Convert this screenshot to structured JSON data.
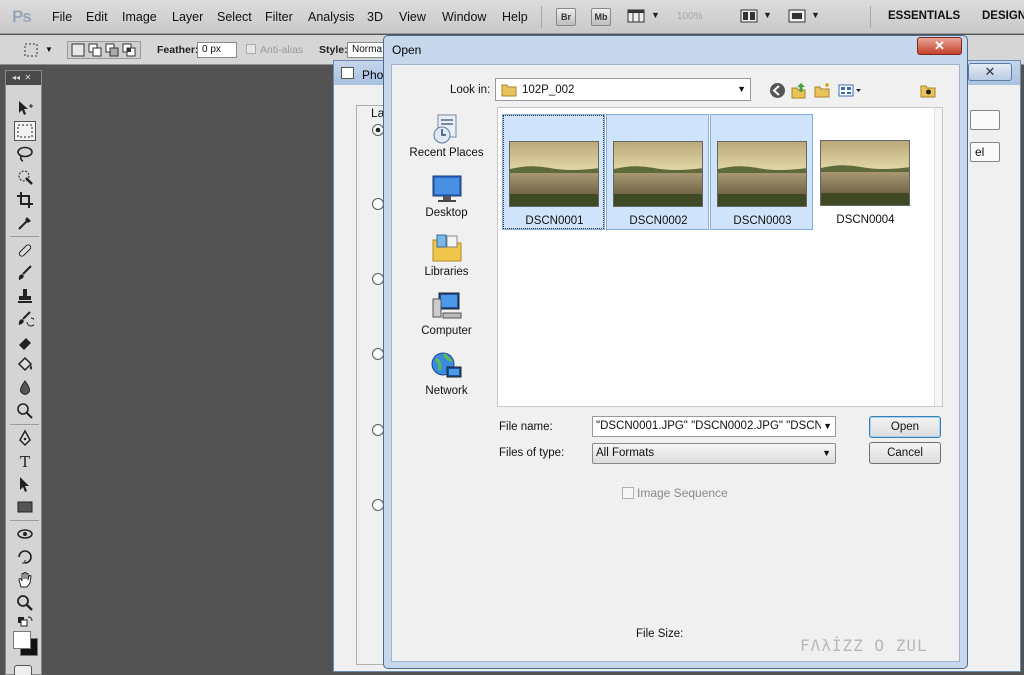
{
  "app": {
    "logo": "Ps",
    "menu": [
      "File",
      "Edit",
      "Image",
      "Layer",
      "Select",
      "Filter",
      "Analysis",
      "3D",
      "View",
      "Window",
      "Help"
    ],
    "bridge_button": "Br",
    "minibridge_button": "Mb",
    "zoom": "100%",
    "workspaces": [
      "ESSENTIALS",
      "DESIGN"
    ]
  },
  "options_bar": {
    "feather_label": "Feather:",
    "feather_value": "0 px",
    "antialias_label": "Anti-alias",
    "style_label": "Style:",
    "style_value": "Norma"
  },
  "photomerge": {
    "title": "Phot",
    "layout_label": "La",
    "side_button_2": "el",
    "close_glyph": "✕"
  },
  "open_dialog": {
    "title": "Open",
    "close_glyph": "✕",
    "look_in_label": "Look in:",
    "look_in_value": "102P_002",
    "places": [
      {
        "label": "Recent Places",
        "icon": "recent-places-icon"
      },
      {
        "label": "Desktop",
        "icon": "desktop-icon"
      },
      {
        "label": "Libraries",
        "icon": "libraries-icon"
      },
      {
        "label": "Computer",
        "icon": "computer-icon"
      },
      {
        "label": "Network",
        "icon": "network-icon"
      }
    ],
    "files": [
      {
        "name": "DSCN0001",
        "selected": true,
        "focused": true
      },
      {
        "name": "DSCN0002",
        "selected": true,
        "focused": false
      },
      {
        "name": "DSCN0003",
        "selected": true,
        "focused": false
      },
      {
        "name": "DSCN0004",
        "selected": false,
        "focused": false
      }
    ],
    "file_name_label": "File name:",
    "file_name_value": "\"DSCN0001.JPG\" \"DSCN0002.JPG\" \"DSCN0",
    "files_of_type_label": "Files of type:",
    "files_of_type_value": "All Formats",
    "open_button": "Open",
    "cancel_button": "Cancel",
    "image_sequence_label": "Image Sequence",
    "file_size_label": "File Size:"
  },
  "watermark": "FΛλİZZ O ZUL",
  "colors": {
    "selection": "#cfe3fb",
    "selection_border": "#84acdd",
    "close_button": "#c4402a",
    "title_bar": "#c7d8ec"
  }
}
